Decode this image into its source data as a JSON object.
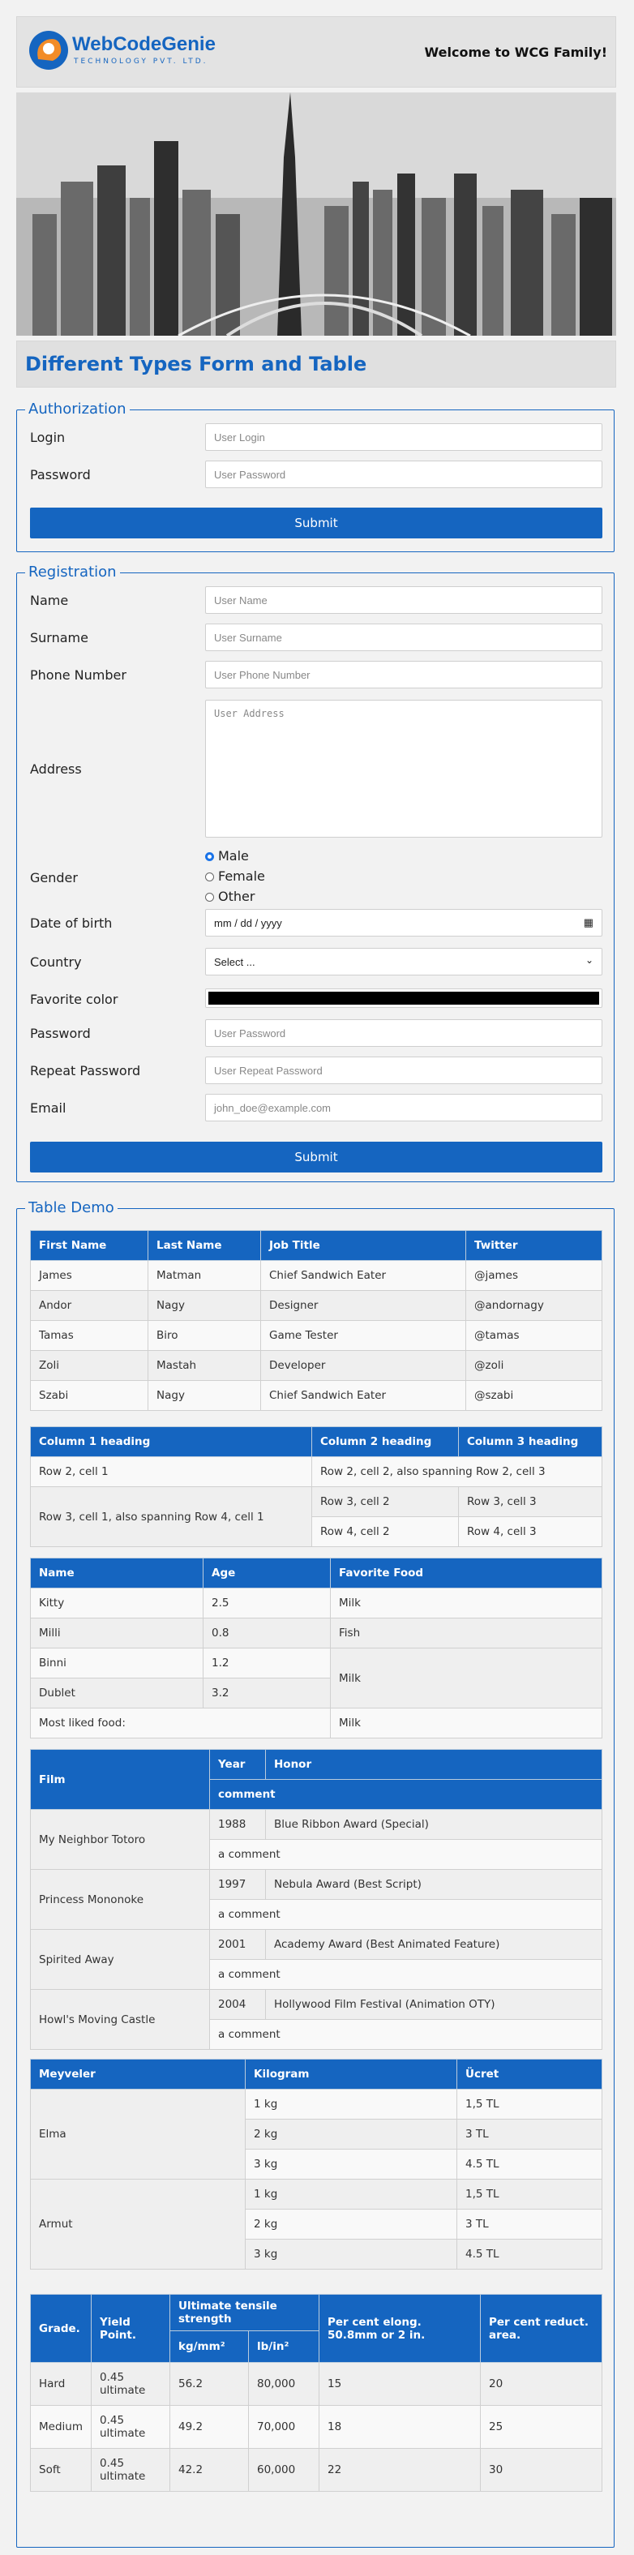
{
  "header": {
    "brand": "WebCodeGenie",
    "tagline": "TECHNOLOGY PVT. LTD.",
    "welcome": "Welcome to WCG Family!"
  },
  "page_title": "Different Types Form and Table",
  "authorization": {
    "legend": "Authorization",
    "login_label": "Login",
    "login_placeholder": "User Login",
    "password_label": "Password",
    "password_placeholder": "User Password",
    "submit": "Submit"
  },
  "registration": {
    "legend": "Registration",
    "name_label": "Name",
    "name_placeholder": "User Name",
    "surname_label": "Surname",
    "surname_placeholder": "User Surname",
    "phone_label": "Phone Number",
    "phone_placeholder": "User Phone Number",
    "address_label": "Address",
    "address_placeholder": "User Address",
    "gender_label": "Gender",
    "gender_options": [
      "Male",
      "Female",
      "Other"
    ],
    "dob_label": "Date of birth",
    "dob_value": "mm / dd / yyyy",
    "country_label": "Country",
    "country_value": "Select ...",
    "color_label": "Favorite color",
    "color_value": "#000000",
    "password_label": "Password",
    "password_placeholder": "User Password",
    "repeat_label": "Repeat Password",
    "repeat_placeholder": "User Repeat Password",
    "email_label": "Email",
    "email_placeholder": "john_doe@example.com",
    "submit": "Submit"
  },
  "table_demo": {
    "legend": "Table Demo",
    "t1": {
      "headers": [
        "First Name",
        "Last Name",
        "Job Title",
        "Twitter"
      ],
      "rows": [
        [
          "James",
          "Matman",
          "Chief Sandwich Eater",
          "@james"
        ],
        [
          "Andor",
          "Nagy",
          "Designer",
          "@andornagy"
        ],
        [
          "Tamas",
          "Biro",
          "Game Tester",
          "@tamas"
        ],
        [
          "Zoli",
          "Mastah",
          "Developer",
          "@zoli"
        ],
        [
          "Szabi",
          "Nagy",
          "Chief Sandwich Eater",
          "@szabi"
        ]
      ]
    },
    "t2": {
      "headers": [
        "Column 1 heading",
        "Column 2 heading",
        "Column 3 heading"
      ],
      "c_r2c1": "Row 2, cell 1",
      "c_r2c2": "Row 2, cell 2, also spanning Row 2, cell 3",
      "c_r3c1": "Row 3, cell 1, also spanning Row 4, cell 1",
      "c_r3c2": "Row 3, cell 2",
      "c_r3c3": "Row 3, cell 3",
      "c_r4c2": "Row 4, cell 2",
      "c_r4c3": "Row 4, cell 3"
    },
    "t3": {
      "headers": [
        "Name",
        "Age",
        "Favorite Food"
      ],
      "r1": [
        "Kitty",
        "2.5",
        "Milk"
      ],
      "r2": [
        "Milli",
        "0.8",
        "Fish"
      ],
      "r3": [
        "Binni",
        "1.2",
        "Milk"
      ],
      "r4": [
        "Dublet",
        "3.2"
      ],
      "r5": [
        "Most liked food:",
        "Milk"
      ]
    },
    "t4": {
      "h_film": "Film",
      "h_year": "Year",
      "h_honor": "Honor",
      "h_comment": "comment",
      "rows": [
        {
          "film": "My Neighbor Totoro",
          "year": "1988",
          "honor": "Blue Ribbon Award (Special)",
          "comment": "a comment"
        },
        {
          "film": "Princess Mononoke",
          "year": "1997",
          "honor": "Nebula Award (Best Script)",
          "comment": "a comment"
        },
        {
          "film": "Spirited Away",
          "year": "2001",
          "honor": "Academy Award (Best Animated Feature)",
          "comment": "a comment"
        },
        {
          "film": "Howl's Moving Castle",
          "year": "2004",
          "honor": "Hollywood Film Festival (Animation OTY)",
          "comment": "a comment"
        }
      ]
    },
    "t5": {
      "headers": [
        "Meyveler",
        "Kilogram",
        "Ücret"
      ],
      "groups": [
        {
          "fruit": "Elma",
          "rows": [
            [
              "1 kg",
              "1,5 TL"
            ],
            [
              "2 kg",
              "3 TL"
            ],
            [
              "3 kg",
              "4.5 TL"
            ]
          ]
        },
        {
          "fruit": "Armut",
          "rows": [
            [
              "1 kg",
              "1,5 TL"
            ],
            [
              "2 kg",
              "3 TL"
            ],
            [
              "3 kg",
              "4.5 TL"
            ]
          ]
        }
      ]
    },
    "t6": {
      "h_grade": "Grade.",
      "h_yield": "Yield Point.",
      "h_uts": "Ultimate tensile strength",
      "h_elong": "Per cent elong. 50.8mm or 2 in.",
      "h_reduct": "Per cent reduct. area.",
      "h_kg": "kg/mm²",
      "h_lb": "lb/in²",
      "rows": [
        [
          "Hard",
          "0.45 ultimate",
          "56.2",
          "80,000",
          "15",
          "20"
        ],
        [
          "Medium",
          "0.45 ultimate",
          "49.2",
          "70,000",
          "18",
          "25"
        ],
        [
          "Soft",
          "0.45 ultimate",
          "42.2",
          "60,000",
          "22",
          "30"
        ]
      ]
    }
  }
}
